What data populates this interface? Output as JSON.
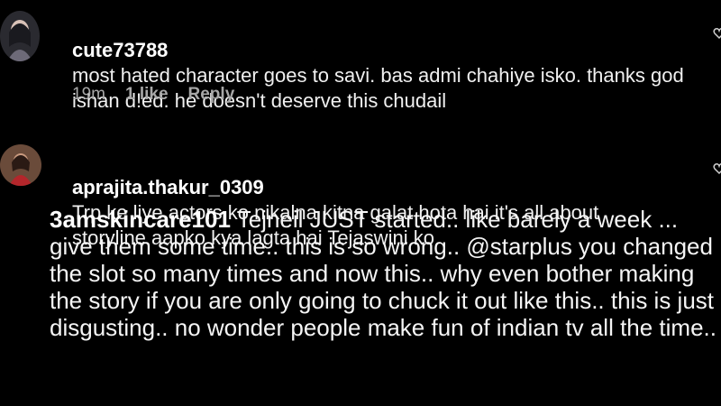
{
  "comments": [
    {
      "username": "cute73788",
      "text": "most hated character goes to savi. bas admi chahiye isko. thanks god ishan d!ed. he doesn't deserve this chudail",
      "time": "19m",
      "likes": "1 like",
      "reply": "Reply"
    },
    {
      "username": "aprajita.thakur_0309",
      "text": "Trp ke liye actors ko nikalna kitna galat hota hai it's all about storyline aapko kya lagta hai Tejaswini ko"
    }
  ],
  "overlay_comment": {
    "username": "3amskincare101",
    "text": "Tejneil JUST started.. like barely a week ... give them some time.. this is so wrong.. @starplus you changed the slot so many times and now this.. why even bother making the story if you are only going to chuck it out like this.. this is just disgusting.. no wonder people make fun of indian tv all the time.."
  }
}
